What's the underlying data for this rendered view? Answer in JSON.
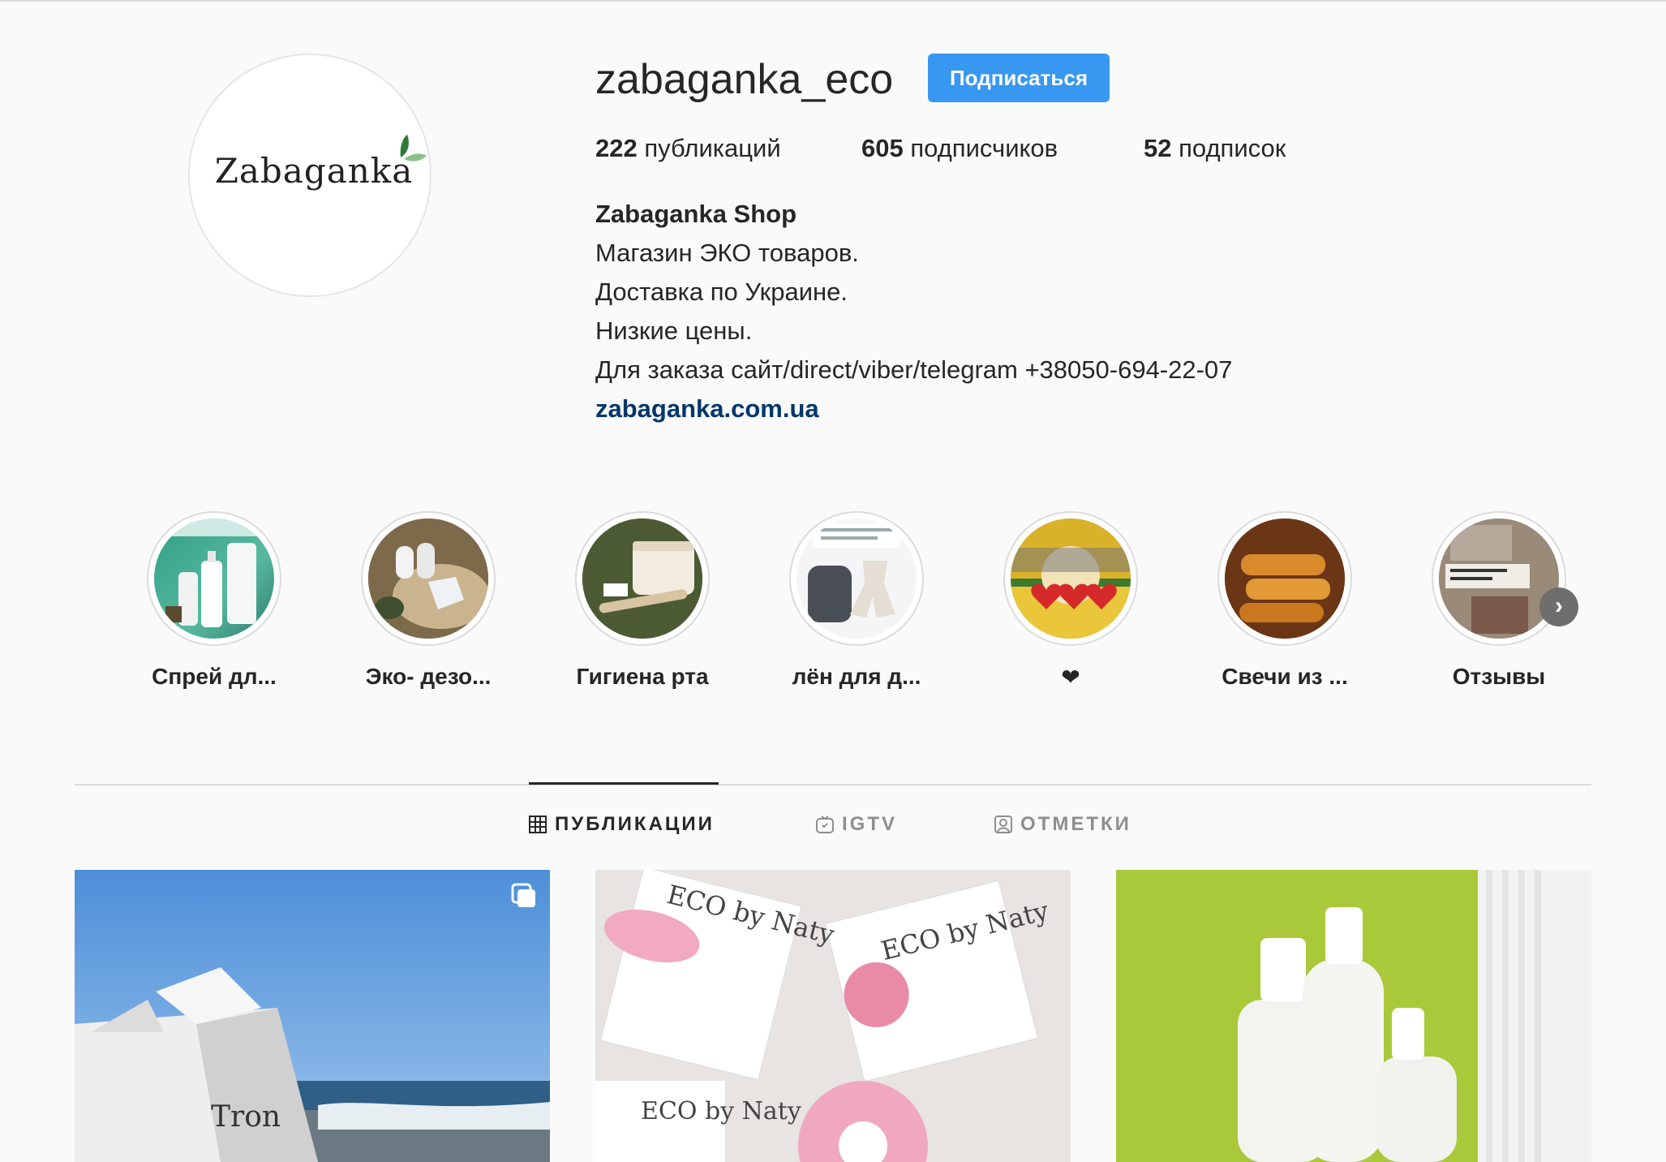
{
  "profile": {
    "avatar_wordmark": "Zabaganka",
    "username": "zabaganka_eco",
    "follow_label": "Подписаться",
    "stats": {
      "posts_count": "222",
      "posts_label": "публикаций",
      "followers_count": "605",
      "followers_label": "подписчиков",
      "following_count": "52",
      "following_label": "подписок"
    },
    "bio": {
      "name": "Zabaganka Shop",
      "lines": [
        "Магазин ЭКО товаров.",
        "Доставка по Украине.",
        "Низкие цены.",
        "Для заказа сайт/direct/viber/telegram +38050-694-22-07"
      ],
      "link": "zabaganka.com.ua"
    }
  },
  "highlights": {
    "items": [
      {
        "label": "Спрей дл..."
      },
      {
        "label": "Эко- дезо..."
      },
      {
        "label": "Гигиена рта"
      },
      {
        "label": "лён для д..."
      },
      {
        "label": "❤"
      },
      {
        "label": "Свечи из ..."
      },
      {
        "label": "Отзывы"
      }
    ],
    "next_icon": "chevron-right-icon"
  },
  "tabs": [
    {
      "label": "ПУБЛИКАЦИИ",
      "icon": "grid-icon",
      "active": true
    },
    {
      "label": "IGTV",
      "icon": "igtv-icon",
      "active": false
    },
    {
      "label": "ОТМЕТКИ",
      "icon": "tagged-icon",
      "active": false
    }
  ],
  "posts": [
    {
      "caption_text": "Tron",
      "icon": "multiple-photos-icon"
    },
    {
      "brand_text": "ECO by Naty"
    },
    {
      "subject": "spray bottles"
    }
  ],
  "colors": {
    "accent": "#3897f0",
    "link": "#00376b",
    "text": "#262626",
    "muted": "#8e8e8e",
    "background": "#fafafa"
  }
}
